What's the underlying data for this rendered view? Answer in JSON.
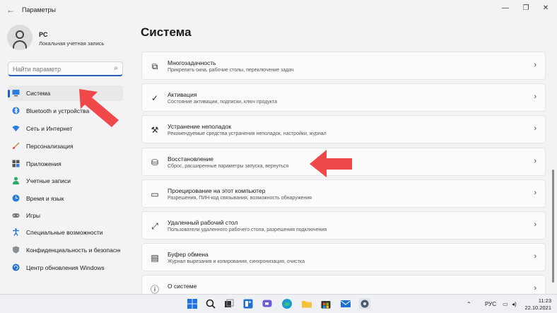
{
  "window": {
    "title": "Параметры",
    "back_icon": "back-arrow-icon",
    "controls": [
      "minimize-icon",
      "maximize-icon",
      "close-icon"
    ]
  },
  "profile": {
    "name": "PC",
    "account_type": "Локальная учетная запись"
  },
  "search": {
    "placeholder": "Найти параметр"
  },
  "sidebar": {
    "items": [
      {
        "label": "Система",
        "icon": "monitor-icon",
        "active": true
      },
      {
        "label": "Bluetooth и устройства",
        "icon": "bluetooth-icon"
      },
      {
        "label": "Сеть и Интернет",
        "icon": "wifi-icon"
      },
      {
        "label": "Персонализация",
        "icon": "brush-icon"
      },
      {
        "label": "Приложения",
        "icon": "apps-icon"
      },
      {
        "label": "Учетные записи",
        "icon": "user-icon"
      },
      {
        "label": "Время и язык",
        "icon": "globe-clock-icon"
      },
      {
        "label": "Игры",
        "icon": "gamepad-icon"
      },
      {
        "label": "Специальные возможности",
        "icon": "accessibility-icon"
      },
      {
        "label": "Конфиденциальность и безопасность",
        "icon": "shield-icon"
      },
      {
        "label": "Центр обновления Windows",
        "icon": "update-icon"
      }
    ]
  },
  "main": {
    "title": "Система",
    "cards": [
      {
        "title": "Многозадачность",
        "subtitle": "Прикрепить окна, рабочие столы, переключение задач",
        "icon": "multitasking-icon"
      },
      {
        "title": "Активация",
        "subtitle": "Состояние активации, подписки, ключ продукта",
        "icon": "activation-check-icon"
      },
      {
        "title": "Устранение неполадок",
        "subtitle": "Рекомендуемые средства устранения неполадок, настройки, журнал",
        "icon": "wrench-icon"
      },
      {
        "title": "Восстановление",
        "subtitle": "Сброс, расширенные параметры запуска, вернуться",
        "icon": "recovery-icon"
      },
      {
        "title": "Проецирование на этот компьютер",
        "subtitle": "Разрешения, ПИН-код связывания, возможность обнаружения",
        "icon": "projection-icon"
      },
      {
        "title": "Удаленный рабочий стол",
        "subtitle": "Пользователи удаленного рабочего стола, разрешения подключения",
        "icon": "remote-desktop-icon"
      },
      {
        "title": "Буфер обмена",
        "subtitle": "Журнал вырезания и копирования, синхронизация, очистка",
        "icon": "clipboard-icon"
      },
      {
        "title": "О системе",
        "subtitle": "",
        "icon": "info-icon"
      }
    ]
  },
  "taskbar": {
    "apps": [
      "windows-start-icon",
      "search-icon",
      "task-view-icon",
      "widgets-icon",
      "chat-icon",
      "edge-icon",
      "file-explorer-icon",
      "store-icon",
      "mail-icon",
      "settings-icon"
    ],
    "language": "РУС",
    "time": "11:23",
    "date": "22.10.2021"
  },
  "colors": {
    "accent": "#1a5fbf",
    "annotation_arrow": "#f04848"
  }
}
